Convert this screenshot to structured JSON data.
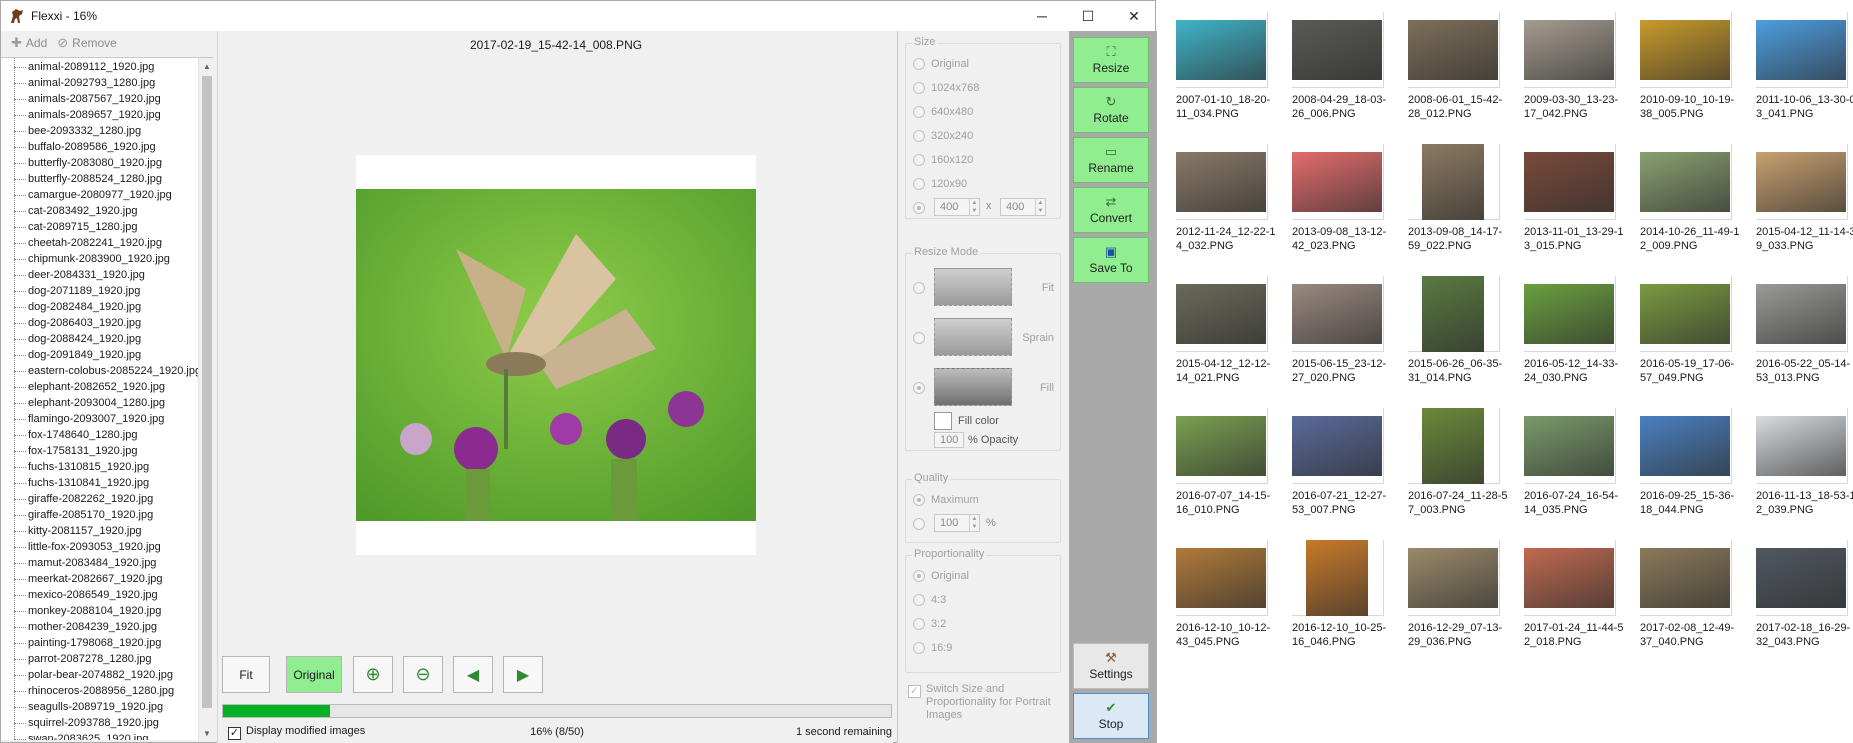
{
  "window": {
    "title": "Flexxi - 16%",
    "minimize": "─",
    "maximize": "☐",
    "close": "✕"
  },
  "toolbar": {
    "add_label": "Add",
    "remove_label": "Remove"
  },
  "files": [
    "animal-2089112_1920.jpg",
    "animal-2092793_1280.jpg",
    "animals-2087567_1920.jpg",
    "animals-2089657_1920.jpg",
    "bee-2093332_1280.jpg",
    "buffalo-2089586_1920.jpg",
    "butterfly-2083080_1920.jpg",
    "butterfly-2088524_1280.jpg",
    "camargue-2080977_1920.jpg",
    "cat-2083492_1920.jpg",
    "cat-2089715_1280.jpg",
    "cheetah-2082241_1920.jpg",
    "chipmunk-2083900_1920.jpg",
    "deer-2084331_1920.jpg",
    "dog-2071189_1920.jpg",
    "dog-2082484_1920.jpg",
    "dog-2086403_1920.jpg",
    "dog-2088424_1920.jpg",
    "dog-2091849_1920.jpg",
    "eastern-colobus-2085224_1920.jpg",
    "elephant-2082652_1920.jpg",
    "elephant-2093004_1280.jpg",
    "flamingo-2093007_1920.jpg",
    "fox-1748640_1280.jpg",
    "fox-1758131_1920.jpg",
    "fuchs-1310815_1920.jpg",
    "fuchs-1310841_1920.jpg",
    "giraffe-2082262_1920.jpg",
    "giraffe-2085170_1920.jpg",
    "kitty-2081157_1920.jpg",
    "little-fox-2093053_1920.jpg",
    "mamut-2083484_1920.jpg",
    "meerkat-2082667_1920.jpg",
    "mexico-2086549_1920.jpg",
    "monkey-2088104_1920.jpg",
    "mother-2084239_1920.jpg",
    "painting-1798068_1920.jpg",
    "parrot-2087278_1280.jpg",
    "polar-bear-2074882_1920.jpg",
    "rhinoceros-2088956_1280.jpg",
    "seagulls-2089719_1920.jpg",
    "squirrel-2093788_1920.jpg",
    "swan-2083625_1920.jpg"
  ],
  "preview": {
    "filename": "2017-02-19_15-42-14_008.PNG",
    "buttons": {
      "fit": "Fit",
      "original": "Original"
    },
    "display_modified_label": "Display modified images",
    "progress_text": "16% (8/50)",
    "progress_fraction": 0.16,
    "time_remaining": "1 second remaining"
  },
  "options": {
    "size": {
      "title": "Size",
      "choices": [
        "Original",
        "1024x768",
        "640x480",
        "320x240",
        "160x120",
        "120x90"
      ],
      "custom_width": "400",
      "custom_height": "400",
      "times": "x"
    },
    "resize_mode": {
      "title": "Resize Mode",
      "modes": [
        "Fit",
        "Sprain",
        "Fill"
      ],
      "fill_color_label": "Fill color",
      "opacity_value": "100",
      "opacity_label": "% Opacity"
    },
    "quality": {
      "title": "Quality",
      "maximum": "Maximum",
      "value": "100",
      "unit": "%"
    },
    "proportionality": {
      "title": "Proportionality",
      "choices": [
        "Original",
        "4:3",
        "3:2",
        "16:9"
      ]
    },
    "switch_label": "Switch Size and Proportionality for Portrait Images"
  },
  "actions": {
    "resize": "Resize",
    "rotate": "Rotate",
    "rename": "Rename",
    "convert": "Convert",
    "save_to": "Save To",
    "settings": "Settings",
    "stop": "Stop"
  },
  "gallery": [
    {
      "caption": "2007-01-10_18-20-11_034.PNG",
      "color": "#3fb4c8"
    },
    {
      "caption": "2008-04-29_18-03-26_006.PNG",
      "color": "#5a5a55"
    },
    {
      "caption": "2008-06-01_15-42-28_012.PNG",
      "color": "#7d6f5a"
    },
    {
      "caption": "2009-03-30_13-23-17_042.PNG",
      "color": "#a59c90"
    },
    {
      "caption": "2010-09-10_10-19-38_005.PNG",
      "color": "#c89a2a"
    },
    {
      "caption": "2011-10-06_13-30-03_041.PNG",
      "color": "#4d9de0"
    },
    {
      "caption": "2012-11-24_12-22-14_032.PNG",
      "color": "#8a7a68"
    },
    {
      "caption": "2013-09-08_13-12-42_023.PNG",
      "color": "#e46c6c"
    },
    {
      "caption": "2013-09-08_14-17-59_022.PNG",
      "color": "#8c7a62",
      "tall": true
    },
    {
      "caption": "2013-11-01_13-29-13_015.PNG",
      "color": "#7a4a3a"
    },
    {
      "caption": "2014-10-26_11-49-12_009.PNG",
      "color": "#8aa070"
    },
    {
      "caption": "2015-04-12_11-14-39_033.PNG",
      "color": "#c8a070"
    },
    {
      "caption": "2015-04-12_12-12-14_021.PNG",
      "color": "#6a6a5a"
    },
    {
      "caption": "2015-06-15_23-12-27_020.PNG",
      "color": "#9a8a80"
    },
    {
      "caption": "2015-06-26_06-35-31_014.PNG",
      "color": "#5a7a40",
      "tall": true
    },
    {
      "caption": "2016-05-12_14-33-24_030.PNG",
      "color": "#6aa040"
    },
    {
      "caption": "2016-05-19_17-06-57_049.PNG",
      "color": "#7a9a40"
    },
    {
      "caption": "2016-05-22_05-14-53_013.PNG",
      "color": "#9a9a98"
    },
    {
      "caption": "2016-07-07_14-15-16_010.PNG",
      "color": "#7aa050"
    },
    {
      "caption": "2016-07-21_12-27-53_007.PNG",
      "color": "#5a6a9a"
    },
    {
      "caption": "2016-07-24_11-28-57_003.PNG",
      "color": "#6a8a3a",
      "tall": true
    },
    {
      "caption": "2016-07-24_16-54-14_035.PNG",
      "color": "#7a9a6a"
    },
    {
      "caption": "2016-09-25_15-36-18_044.PNG",
      "color": "#4a80c0"
    },
    {
      "caption": "2016-11-13_18-53-12_039.PNG",
      "color": "#d8dce0"
    },
    {
      "caption": "2016-12-10_10-12-43_045.PNG",
      "color": "#b07a3a"
    },
    {
      "caption": "2016-12-10_10-25-16_046.PNG",
      "color": "#c87a2a",
      "tall": true
    },
    {
      "caption": "2016-12-29_07-13-29_036.PNG",
      "color": "#9a8a6a"
    },
    {
      "caption": "2017-01-24_11-44-52_018.PNG",
      "color": "#c06a50"
    },
    {
      "caption": "2017-02-08_12-49-37_040.PNG",
      "color": "#8a7a5a"
    },
    {
      "caption": "2017-02-18_16-29-32_043.PNG",
      "color": "#505860"
    }
  ]
}
